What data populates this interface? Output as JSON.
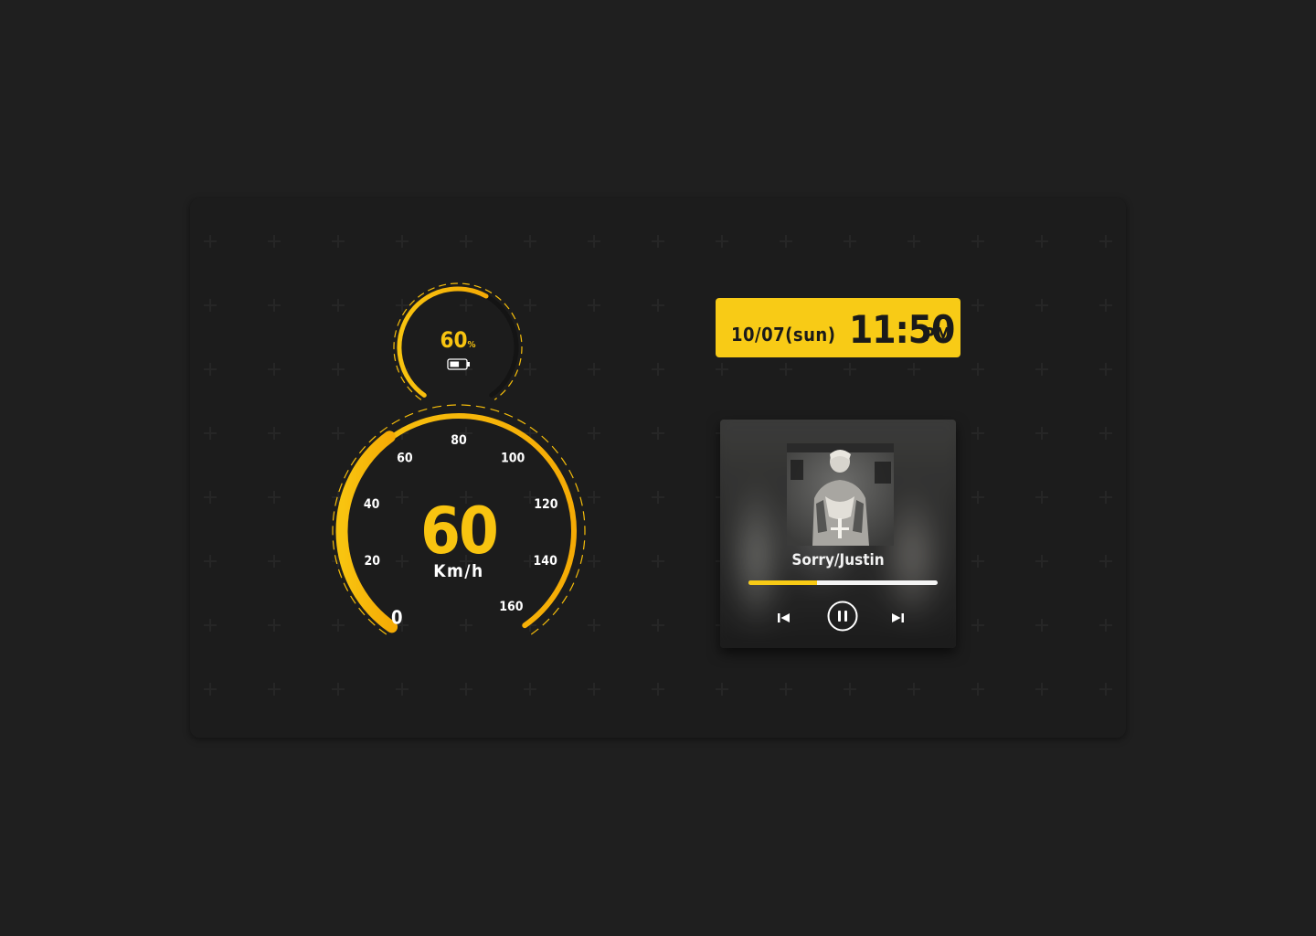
{
  "battery": {
    "value": "60",
    "unit": "%",
    "level": 0.6,
    "icon": "battery-icon"
  },
  "speedometer": {
    "value": "60",
    "unit": "Km/h",
    "speed": 60,
    "max": 160,
    "ticks": [
      "0",
      "20",
      "40",
      "60",
      "80",
      "100",
      "120",
      "140",
      "160"
    ]
  },
  "clock": {
    "date": "10/07(sun)",
    "time": "11:50",
    "ampm": "PM"
  },
  "player": {
    "song": "Sorry/Justin",
    "progress": 0.36,
    "icons": {
      "previous": "skip-previous-icon",
      "pause": "pause-icon",
      "next": "skip-next-icon"
    }
  },
  "colors": {
    "accent": "#f8cb16",
    "accent_dark": "#f5a800",
    "background": "#1f1f1f",
    "panel": "#1c1c1c"
  }
}
